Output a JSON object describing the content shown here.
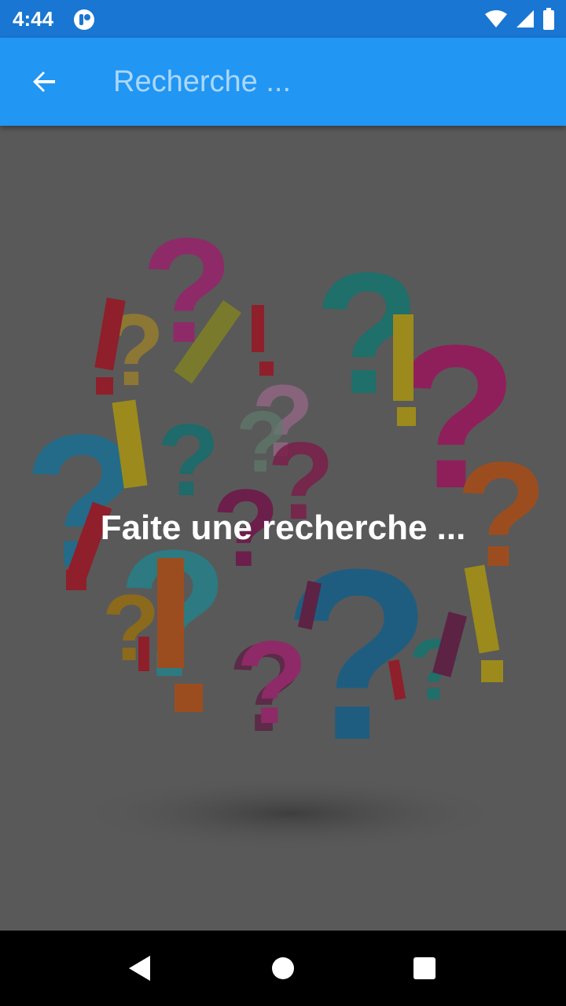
{
  "status_bar": {
    "time": "4:44",
    "icons": [
      "app-notification-icon",
      "wifi-icon",
      "cellular-signal-icon",
      "battery-icon"
    ]
  },
  "app_bar": {
    "back_icon": "arrow-back-icon",
    "search_placeholder": "Recherche ...",
    "search_value": ""
  },
  "main": {
    "empty_message": "Faite une recherche ...",
    "illustration": "question-and-exclamation-marks-illustration"
  },
  "nav_bar": {
    "icons": [
      "nav-back-icon",
      "nav-home-icon",
      "nav-recents-icon"
    ]
  },
  "colors": {
    "status_bar": "#1976d2",
    "app_bar": "#2196f3",
    "content_background": "#595959",
    "nav_bar": "#000000"
  }
}
